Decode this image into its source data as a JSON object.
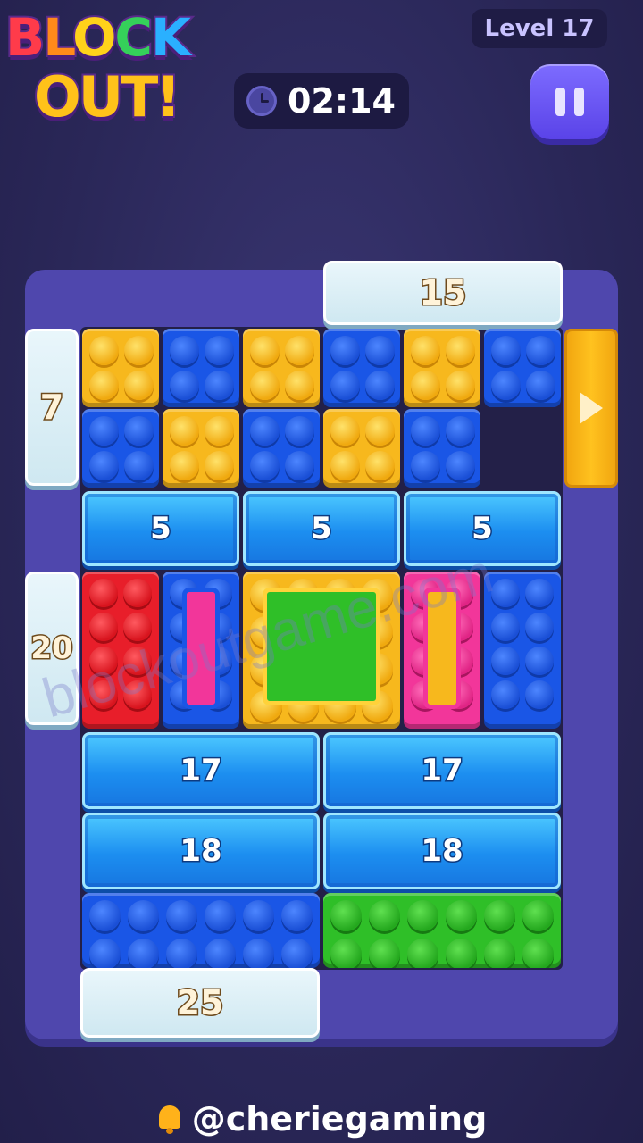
{
  "header": {
    "logo_line1": [
      "B",
      "L",
      "O",
      "C",
      "K"
    ],
    "logo_line2": "OUT!",
    "level_label": "Level 17",
    "timer": "02:14",
    "pause_icon": "pause-icon"
  },
  "board": {
    "top_snow": "15",
    "left_snow_top": "7",
    "left_snow_mid": "20",
    "bottom_snow": "25",
    "ice_row1": [
      "5",
      "5",
      "5"
    ],
    "ice_row2": [
      "17",
      "17"
    ],
    "ice_row3": [
      "18",
      "18"
    ],
    "gate_icon": "play-arrow-icon",
    "colors": {
      "yellow": "#f7b81d",
      "blue": "#1a56e6",
      "red": "#e81e2a",
      "green": "#2fbf28",
      "pink": "#f2369a",
      "gate": "#ffc21f"
    }
  },
  "watermark": "blockoutgame.com",
  "footer": {
    "handle": "@cheriegaming",
    "icon": "bell-icon"
  }
}
